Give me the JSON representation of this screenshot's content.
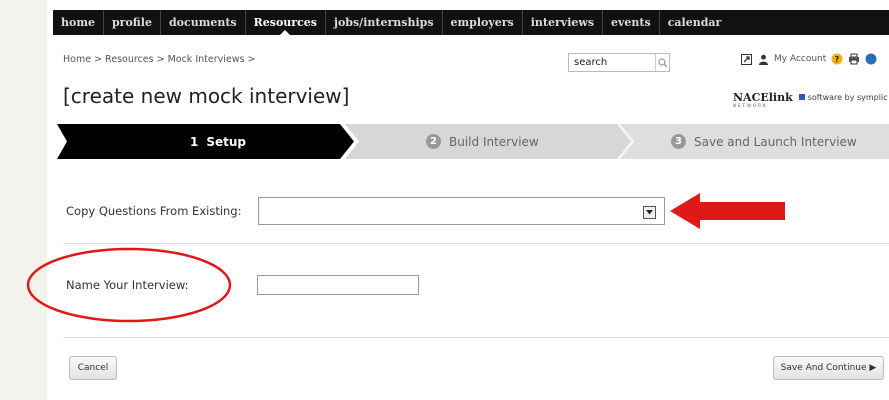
{
  "nav": {
    "items": [
      {
        "label": "home"
      },
      {
        "label": "profile"
      },
      {
        "label": "documents"
      },
      {
        "label": "Resources"
      },
      {
        "label": "jobs/internships"
      },
      {
        "label": "employers"
      },
      {
        "label": "interviews"
      },
      {
        "label": "events"
      },
      {
        "label": "calendar"
      }
    ],
    "active": "Resources"
  },
  "breadcrumb": "Home > Resources > Mock Interviews >",
  "search": {
    "value": "search"
  },
  "account": {
    "label": "My Account"
  },
  "page": {
    "title": "[create new mock interview]"
  },
  "brand": {
    "nacelink": "NACElink",
    "network": "NETWORK",
    "software": "software by symplic"
  },
  "wizard": {
    "steps": [
      {
        "num": "1",
        "label": "Setup"
      },
      {
        "num": "2",
        "label": "Build Interview"
      },
      {
        "num": "3",
        "label": "Save and Launch Interview"
      }
    ],
    "current_step": 1
  },
  "form": {
    "copy_label": "Copy Questions From Existing:",
    "copy_value": "",
    "name_label": "Name Your Interview:",
    "name_value": ""
  },
  "buttons": {
    "cancel": "Cancel",
    "save": "Save And Continue ▶"
  },
  "colors": {
    "nav_bg": "#111111",
    "active_step": "#000000",
    "inactive_step": "#d6d6d6",
    "annotation": "#e01010"
  }
}
